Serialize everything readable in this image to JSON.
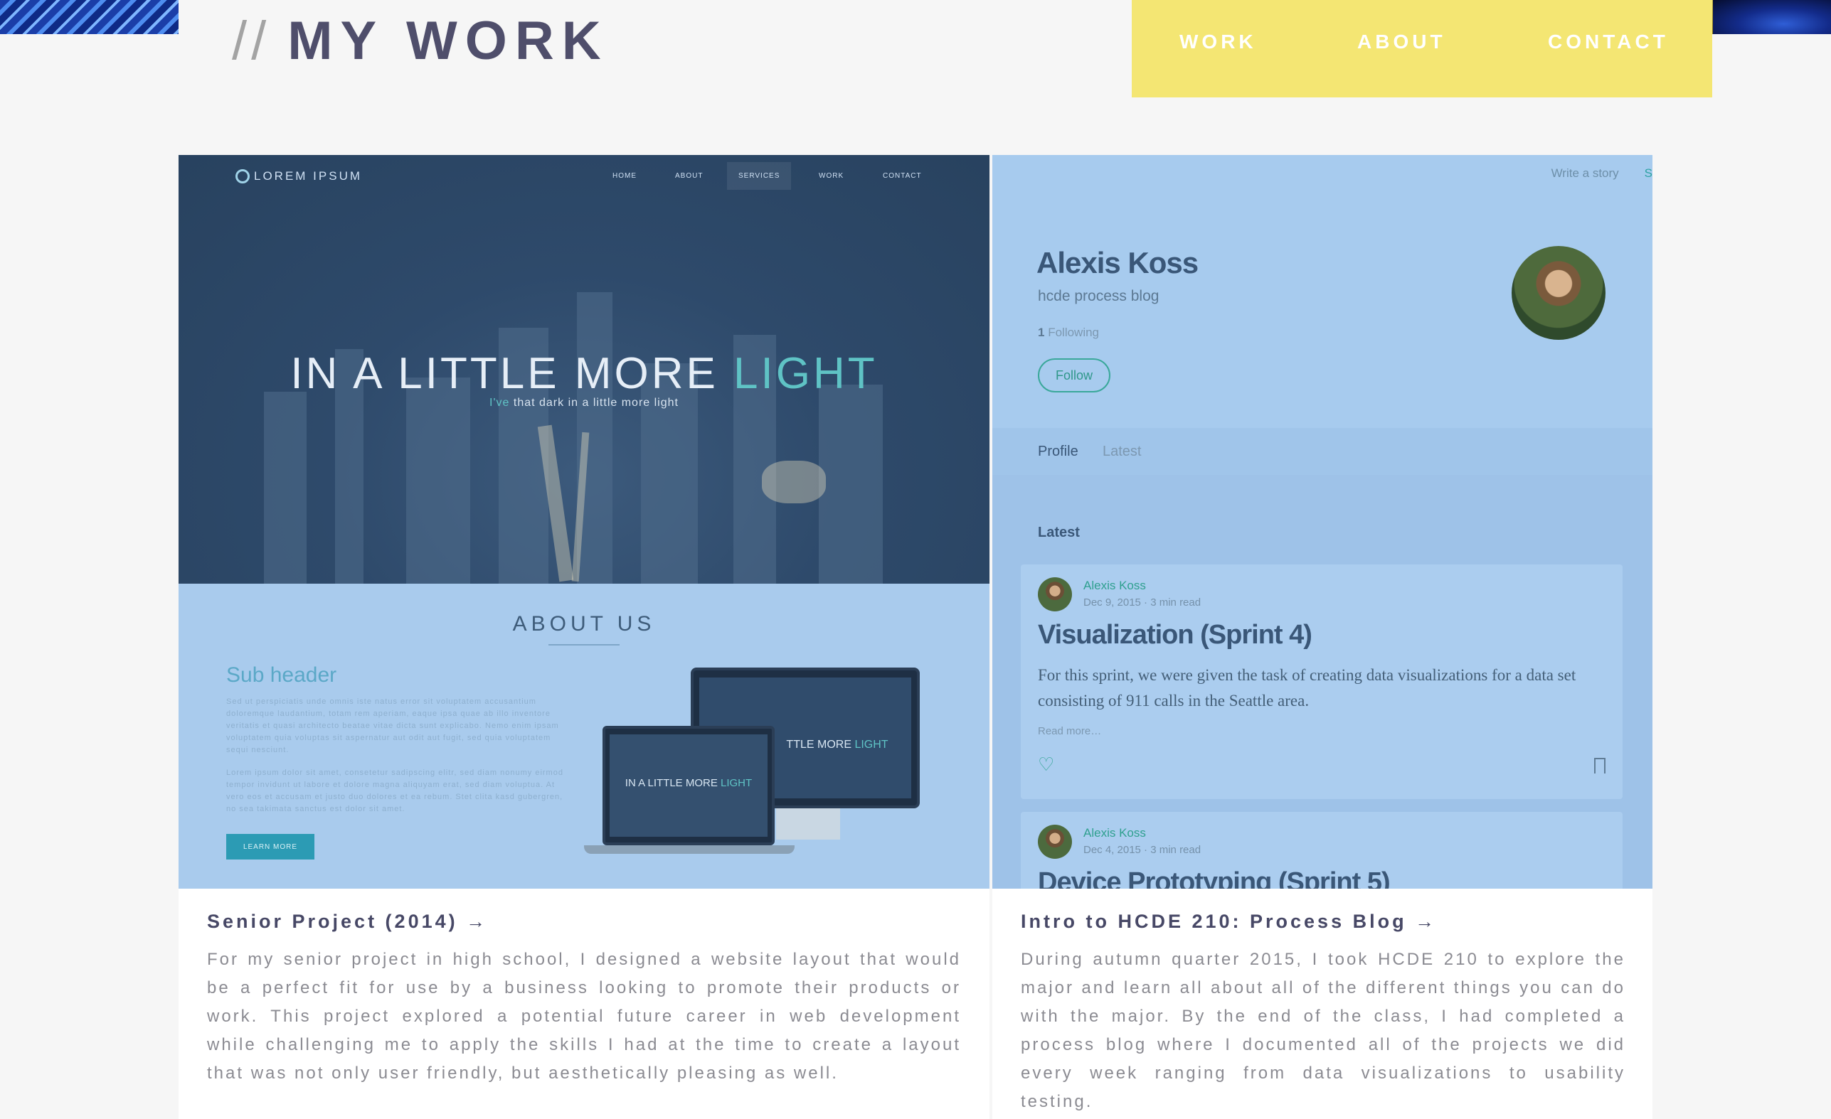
{
  "header": {
    "title_prefix": "//",
    "title": "MY WORK",
    "nav": [
      "WORK",
      "ABOUT",
      "CONTACT"
    ]
  },
  "projects": [
    {
      "preview": {
        "logo": "LOREM IPSUM",
        "nav": [
          "HOME",
          "ABOUT",
          "SERVICES",
          "WORK",
          "CONTACT"
        ],
        "hero_title_main": "IN A LITTLE MORE ",
        "hero_title_accent": "LIGHT",
        "hero_sub_accent": "I've",
        "hero_sub_rest": "that dark in a little more light",
        "about_title": "ABOUT US",
        "sub_header": "Sub header",
        "lorem_1": "Sed ut perspiciatis unde omnis iste natus error sit voluptatem accusantium doloremque laudantium, totam rem aperiam, eaque ipsa quae ab illo inventore veritatis et quasi architecto beatae vitae dicta sunt explicabo. Nemo enim ipsam voluptatem quia voluptas sit aspernatur aut odit aut fugit, sed quia voluptatem sequi nesciunt.",
        "lorem_2": "Lorem ipsum dolor sit amet, consetetur sadipscing elitr, sed diam nonumy eirmod tempor invidunt ut labore et dolore magna aliquyam erat, sed diam voluptua. At vero eos et accusam et justo duo dolores et ea rebum. Stet clita kasd gubergren, no sea takimata sanctus est dolor sit amet.",
        "learn_more": "LEARN MORE",
        "device_title_monitor_main": "TTLE MORE ",
        "device_title_monitor_accent": "LIGHT",
        "device_title_laptop_main": "IN A LITTLE MORE ",
        "device_title_laptop_accent": "LIGHT"
      },
      "title": "Senior Project (2014) →",
      "description": "For my senior project in high school, I designed a website layout that would be a perfect fit for use by a business looking to promote their products or work. This project explored a potential future career in web development while challenging me to apply the skills I had at the time to create a layout that was not only user friendly, but aesthetically pleasing as well."
    },
    {
      "preview": {
        "write_story": "Write a story",
        "cut_link": "S",
        "name": "Alexis Koss",
        "blog_name": "hcde process blog",
        "following_count": "1",
        "following_label": "Following",
        "follow_button": "Follow",
        "tabs": [
          "Profile",
          "Latest"
        ],
        "latest_label": "Latest",
        "posts": [
          {
            "author": "Alexis Koss",
            "meta": "Dec 9, 2015 · 3 min read",
            "title": "Visualization (Sprint 4)",
            "excerpt": "For this sprint, we were given the task of creating data visualizations for a data set consisting of 911 calls in the Seattle area.",
            "read_more": "Read more…"
          },
          {
            "author": "Alexis Koss",
            "meta": "Dec 4, 2015 · 3 min read",
            "title": "Device Prototyping (Sprint 5)"
          }
        ]
      },
      "title": "Intro to HCDE 210: Process Blog →",
      "description": "During autumn quarter 2015, I took HCDE 210 to explore the major and learn all about all of the different things you can do with the major. By the end of the class, I had completed a process blog where I documented all of the projects we did every week ranging from data visualizations to usability testing."
    }
  ],
  "icons": {
    "logo_ring": "ring-icon",
    "heart": "heart-icon",
    "bookmark": "bookmark-icon"
  },
  "colors": {
    "nav_background": "#f4e673",
    "title": "#4f4e6b",
    "accent_teal": "#5fc3c5",
    "preview_blue": "#a9cbed"
  }
}
